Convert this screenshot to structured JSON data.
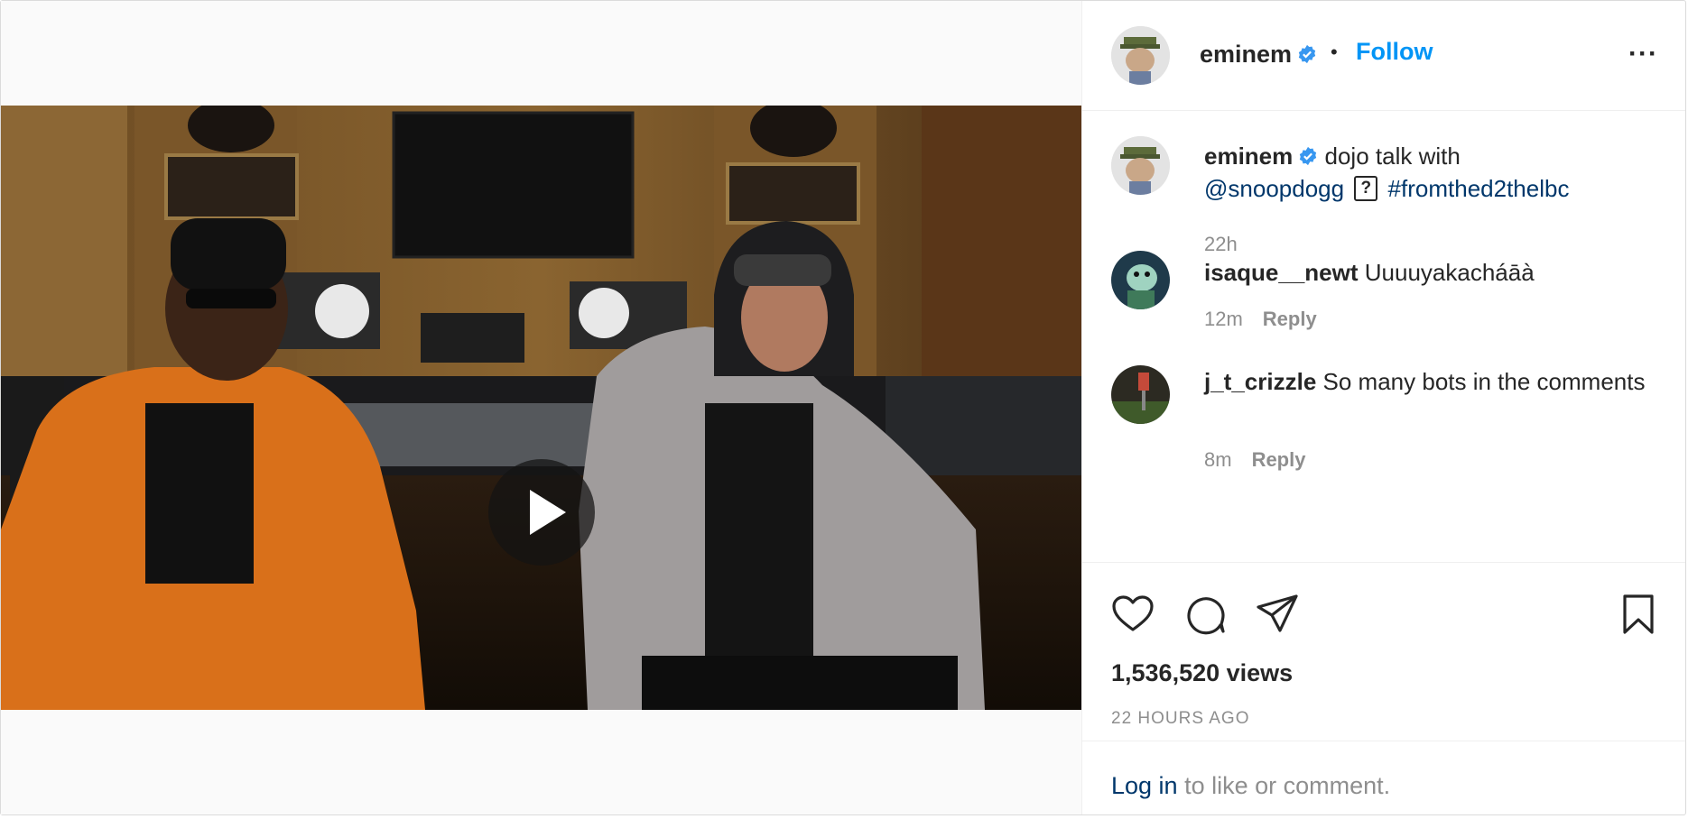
{
  "media": {
    "kind": "video",
    "play_icon": "play-icon"
  },
  "header": {
    "username": "eminem",
    "verified_icon": "verified-badge-icon",
    "separator": "•",
    "follow_label": "Follow",
    "more_icon": "more-options-icon",
    "more_label": "···"
  },
  "caption": {
    "username": "eminem",
    "text_before": "dojo talk with",
    "mention": "@snoopdogg",
    "emoji_placeholder": "?",
    "hashtag": "#fromthed2thelbc",
    "time": "22h"
  },
  "comments": [
    {
      "username": "isaque__newt",
      "text": "Uuuuyakacháāà",
      "time": "12m",
      "reply_label": "Reply"
    },
    {
      "username": "j_t_crizzle",
      "text": "So many bots in the comments",
      "time": "8m",
      "reply_label": "Reply"
    }
  ],
  "actions": {
    "like_icon": "heart-icon",
    "comment_icon": "comment-icon",
    "share_icon": "share-icon",
    "save_icon": "bookmark-icon"
  },
  "stats": {
    "views": "1,536,520 views",
    "time_ago": "22 HOURS AGO"
  },
  "footer": {
    "login_link": "Log in",
    "login_rest": " to like or comment."
  },
  "colors": {
    "accent": "#0095f6",
    "link": "#00376b",
    "muted": "#8e8e8e",
    "text": "#262626",
    "verified": "#3897f0"
  }
}
